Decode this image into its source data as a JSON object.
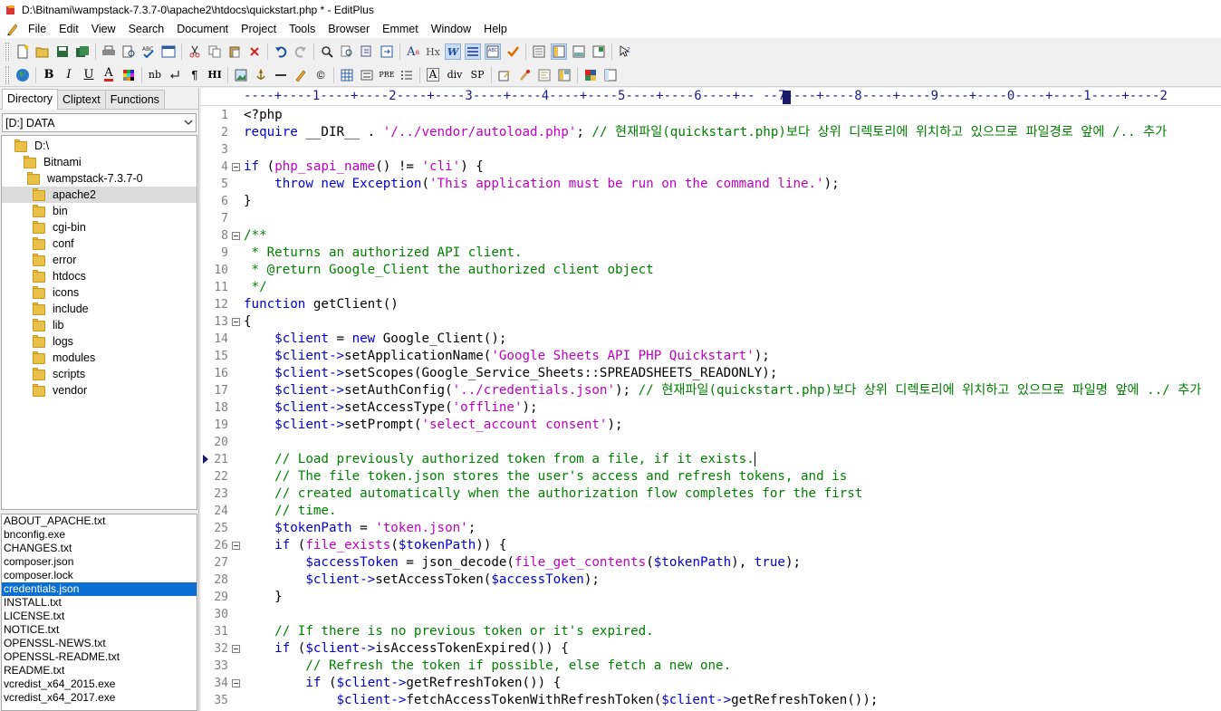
{
  "title": "D:\\Bitnami\\wampstack-7.3.7-0\\apache2\\htdocs\\quickstart.php * - EditPlus",
  "menu": [
    "File",
    "Edit",
    "View",
    "Search",
    "Document",
    "Project",
    "Tools",
    "Browser",
    "Emmet",
    "Window",
    "Help"
  ],
  "toolbar2_labels": {
    "hx": "Hx",
    "w": "W",
    "pre": "PRE",
    "nb": "nb",
    "para": "¶",
    "hi": "HI",
    "div": "div",
    "sp": "SP",
    "b": "B",
    "i": "I",
    "u": "U",
    "a": "A"
  },
  "panel": {
    "tabs": [
      "Directory",
      "Cliptext",
      "Functions"
    ],
    "drive": "[D:] DATA",
    "tree": [
      "D:\\",
      "Bitnami",
      "wampstack-7.3.7-0",
      "apache2",
      "bin",
      "cgi-bin",
      "conf",
      "error",
      "htdocs",
      "icons",
      "include",
      "lib",
      "logs",
      "modules",
      "scripts",
      "vendor"
    ],
    "files": [
      "ABOUT_APACHE.txt",
      "bnconfig.exe",
      "CHANGES.txt",
      "composer.json",
      "composer.lock",
      "credentials.json",
      "INSTALL.txt",
      "LICENSE.txt",
      "NOTICE.txt",
      "OPENSSL-NEWS.txt",
      "OPENSSL-README.txt",
      "README.txt",
      "vcredist_x64_2015.exe",
      "vcredist_x64_2017.exe"
    ],
    "selected_file": "credentials.json",
    "selected_folder": "apache2"
  },
  "ruler": "----+----1----+----2----+----3----+----4----+----5----+----6----+-- --7----+----8----+----9----+----0----+----1----+----2",
  "editor": {
    "current_line": "21",
    "lines": [
      {
        "n": "1",
        "fold": false,
        "tokens": [
          [
            "pl",
            "<?php"
          ]
        ]
      },
      {
        "n": "2",
        "fold": false,
        "tokens": [
          [
            "kw",
            "require"
          ],
          [
            "pl",
            " __DIR__ . "
          ],
          [
            "str",
            "'/../vendor/autoload.php'"
          ],
          [
            "pl",
            "; "
          ],
          [
            "cm",
            "// 현재파일(quickstart.php)보다 상위 디렉토리에 위치하고 있으므로 파일경로 앞에 /.. 추가"
          ]
        ]
      },
      {
        "n": "3",
        "fold": false,
        "tokens": []
      },
      {
        "n": "4",
        "fold": true,
        "tokens": [
          [
            "kw",
            "if"
          ],
          [
            "pl",
            " ("
          ],
          [
            "str",
            "php_sapi_name"
          ],
          [
            "pl",
            "() != "
          ],
          [
            "str",
            "'cli'"
          ],
          [
            "pl",
            ") {"
          ]
        ]
      },
      {
        "n": "5",
        "fold": false,
        "tokens": [
          [
            "pl",
            "    "
          ],
          [
            "kw",
            "throw new"
          ],
          [
            "pl",
            " "
          ],
          [
            "kw",
            "Exception"
          ],
          [
            "pl",
            "("
          ],
          [
            "str",
            "'This application must be run on the command line.'"
          ],
          [
            "pl",
            ");"
          ]
        ]
      },
      {
        "n": "6",
        "fold": false,
        "tokens": [
          [
            "pl",
            "}"
          ]
        ]
      },
      {
        "n": "7",
        "fold": false,
        "tokens": []
      },
      {
        "n": "8",
        "fold": true,
        "tokens": [
          [
            "cm",
            "/**"
          ]
        ]
      },
      {
        "n": "9",
        "fold": false,
        "tokens": [
          [
            "cm",
            " * Returns an authorized API client."
          ]
        ]
      },
      {
        "n": "10",
        "fold": false,
        "tokens": [
          [
            "cm",
            " * @return Google_Client the authorized client object"
          ]
        ]
      },
      {
        "n": "11",
        "fold": false,
        "tokens": [
          [
            "cm",
            " */"
          ]
        ]
      },
      {
        "n": "12",
        "fold": false,
        "tokens": [
          [
            "kw",
            "function"
          ],
          [
            "pl",
            " getClient()"
          ]
        ]
      },
      {
        "n": "13",
        "fold": true,
        "tokens": [
          [
            "pl",
            "{"
          ]
        ]
      },
      {
        "n": "14",
        "fold": false,
        "tokens": [
          [
            "pl",
            "    "
          ],
          [
            "var",
            "$client"
          ],
          [
            "pl",
            " = "
          ],
          [
            "kw",
            "new"
          ],
          [
            "pl",
            " Google_Client();"
          ]
        ]
      },
      {
        "n": "15",
        "fold": false,
        "tokens": [
          [
            "pl",
            "    "
          ],
          [
            "var",
            "$client->"
          ],
          [
            "pl",
            "setApplicationName("
          ],
          [
            "str",
            "'Google Sheets API PHP Quickstart'"
          ],
          [
            "pl",
            ");"
          ]
        ]
      },
      {
        "n": "16",
        "fold": false,
        "tokens": [
          [
            "pl",
            "    "
          ],
          [
            "var",
            "$client->"
          ],
          [
            "pl",
            "setScopes(Google_Service_Sheets::SPREADSHEETS_READONLY);"
          ]
        ]
      },
      {
        "n": "17",
        "fold": false,
        "tokens": [
          [
            "pl",
            "    "
          ],
          [
            "var",
            "$client->"
          ],
          [
            "pl",
            "setAuthConfig("
          ],
          [
            "str",
            "'../credentials.json'"
          ],
          [
            "pl",
            "); "
          ],
          [
            "cm",
            "// 현재파일(quickstart.php)보다 상위 디렉토리에 위치하고 있으므로 파일명 앞에 ../ 추가"
          ]
        ]
      },
      {
        "n": "18",
        "fold": false,
        "tokens": [
          [
            "pl",
            "    "
          ],
          [
            "var",
            "$client->"
          ],
          [
            "pl",
            "setAccessType("
          ],
          [
            "str",
            "'offline'"
          ],
          [
            "pl",
            ");"
          ]
        ]
      },
      {
        "n": "19",
        "fold": false,
        "tokens": [
          [
            "pl",
            "    "
          ],
          [
            "var",
            "$client->"
          ],
          [
            "pl",
            "setPrompt("
          ],
          [
            "str",
            "'select_account consent'"
          ],
          [
            "pl",
            ");"
          ]
        ]
      },
      {
        "n": "20",
        "fold": false,
        "tokens": []
      },
      {
        "n": "21",
        "fold": false,
        "tokens": [
          [
            "pl",
            "    "
          ],
          [
            "cm",
            "// Load previously authorized token from a file, if it exists."
          ]
        ],
        "caret": true
      },
      {
        "n": "22",
        "fold": false,
        "tokens": [
          [
            "pl",
            "    "
          ],
          [
            "cm",
            "// The file token.json stores the user's access and refresh tokens, and is"
          ]
        ]
      },
      {
        "n": "23",
        "fold": false,
        "tokens": [
          [
            "pl",
            "    "
          ],
          [
            "cm",
            "// created automatically when the authorization flow completes for the first"
          ]
        ]
      },
      {
        "n": "24",
        "fold": false,
        "tokens": [
          [
            "pl",
            "    "
          ],
          [
            "cm",
            "// time."
          ]
        ]
      },
      {
        "n": "25",
        "fold": false,
        "tokens": [
          [
            "pl",
            "    "
          ],
          [
            "var",
            "$tokenPath"
          ],
          [
            "pl",
            " = "
          ],
          [
            "str",
            "'token.json'"
          ],
          [
            "pl",
            ";"
          ]
        ]
      },
      {
        "n": "26",
        "fold": true,
        "tokens": [
          [
            "pl",
            "    "
          ],
          [
            "kw",
            "if"
          ],
          [
            "pl",
            " ("
          ],
          [
            "str",
            "file_exists"
          ],
          [
            "pl",
            "("
          ],
          [
            "var",
            "$tokenPath"
          ],
          [
            "pl",
            ")) {"
          ]
        ]
      },
      {
        "n": "27",
        "fold": false,
        "tokens": [
          [
            "pl",
            "        "
          ],
          [
            "var",
            "$accessToken"
          ],
          [
            "pl",
            " = json_decode("
          ],
          [
            "str",
            "file_get_contents"
          ],
          [
            "pl",
            "("
          ],
          [
            "var",
            "$tokenPath"
          ],
          [
            "pl",
            "), "
          ],
          [
            "kw",
            "true"
          ],
          [
            "pl",
            ");"
          ]
        ]
      },
      {
        "n": "28",
        "fold": false,
        "tokens": [
          [
            "pl",
            "        "
          ],
          [
            "var",
            "$client->"
          ],
          [
            "pl",
            "setAccessToken("
          ],
          [
            "var",
            "$accessToken"
          ],
          [
            "pl",
            ");"
          ]
        ]
      },
      {
        "n": "29",
        "fold": false,
        "tokens": [
          [
            "pl",
            "    }"
          ]
        ]
      },
      {
        "n": "30",
        "fold": false,
        "tokens": []
      },
      {
        "n": "31",
        "fold": false,
        "tokens": [
          [
            "pl",
            "    "
          ],
          [
            "cm",
            "// If there is no previous token or it's expired."
          ]
        ]
      },
      {
        "n": "32",
        "fold": true,
        "tokens": [
          [
            "pl",
            "    "
          ],
          [
            "kw",
            "if"
          ],
          [
            "pl",
            " ("
          ],
          [
            "var",
            "$client->"
          ],
          [
            "pl",
            "isAccessTokenExpired()) {"
          ]
        ]
      },
      {
        "n": "33",
        "fold": false,
        "tokens": [
          [
            "pl",
            "        "
          ],
          [
            "cm",
            "// Refresh the token if possible, else fetch a new one."
          ]
        ]
      },
      {
        "n": "34",
        "fold": true,
        "tokens": [
          [
            "pl",
            "        "
          ],
          [
            "kw",
            "if"
          ],
          [
            "pl",
            " ("
          ],
          [
            "var",
            "$client->"
          ],
          [
            "pl",
            "getRefreshToken()) {"
          ]
        ]
      },
      {
        "n": "35",
        "fold": false,
        "tokens": [
          [
            "pl",
            "            "
          ],
          [
            "var",
            "$client->"
          ],
          [
            "pl",
            "fetchAccessTokenWithRefreshToken("
          ],
          [
            "var",
            "$client->"
          ],
          [
            "pl",
            "getRefreshToken());"
          ]
        ]
      }
    ]
  },
  "colors": {
    "keyword": "#0000d0",
    "string": "#c000c0",
    "comment": "#008000",
    "selection": "#0a6fd1",
    "folder": "#e8c04a"
  }
}
